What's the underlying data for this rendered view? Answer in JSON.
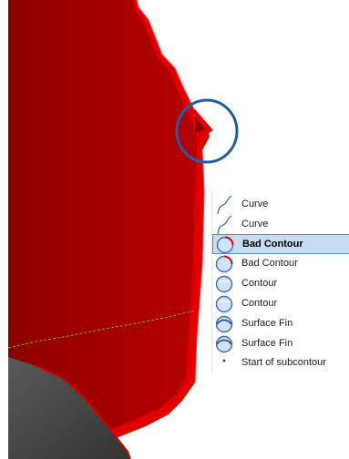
{
  "list": {
    "items": [
      {
        "label": "Curve",
        "icon": "curve-icon",
        "selected": false
      },
      {
        "label": "Curve",
        "icon": "curve-icon",
        "selected": false
      },
      {
        "label": "Bad Contour",
        "icon": "bad-contour-icon",
        "selected": true
      },
      {
        "label": "Bad Contour",
        "icon": "bad-contour-icon",
        "selected": false
      },
      {
        "label": "Contour",
        "icon": "contour-icon",
        "selected": false
      },
      {
        "label": "Contour",
        "icon": "contour-icon",
        "selected": false
      },
      {
        "label": "Surface Fin",
        "icon": "surface-fin-icon",
        "selected": false
      },
      {
        "label": "Surface Fin",
        "icon": "surface-fin-icon",
        "selected": false
      },
      {
        "label": "Start of subcontour",
        "icon": "dot-icon",
        "selected": false
      }
    ]
  },
  "colors": {
    "model_fill": "#a30000",
    "model_edge": "#e80000",
    "dark_part": "#4b4b4b",
    "highlight_ring": "#1f5fa8",
    "selection_bg": "#c6dcf3",
    "selection_border": "#5d8fd0",
    "seam_line": "#6bb800"
  }
}
